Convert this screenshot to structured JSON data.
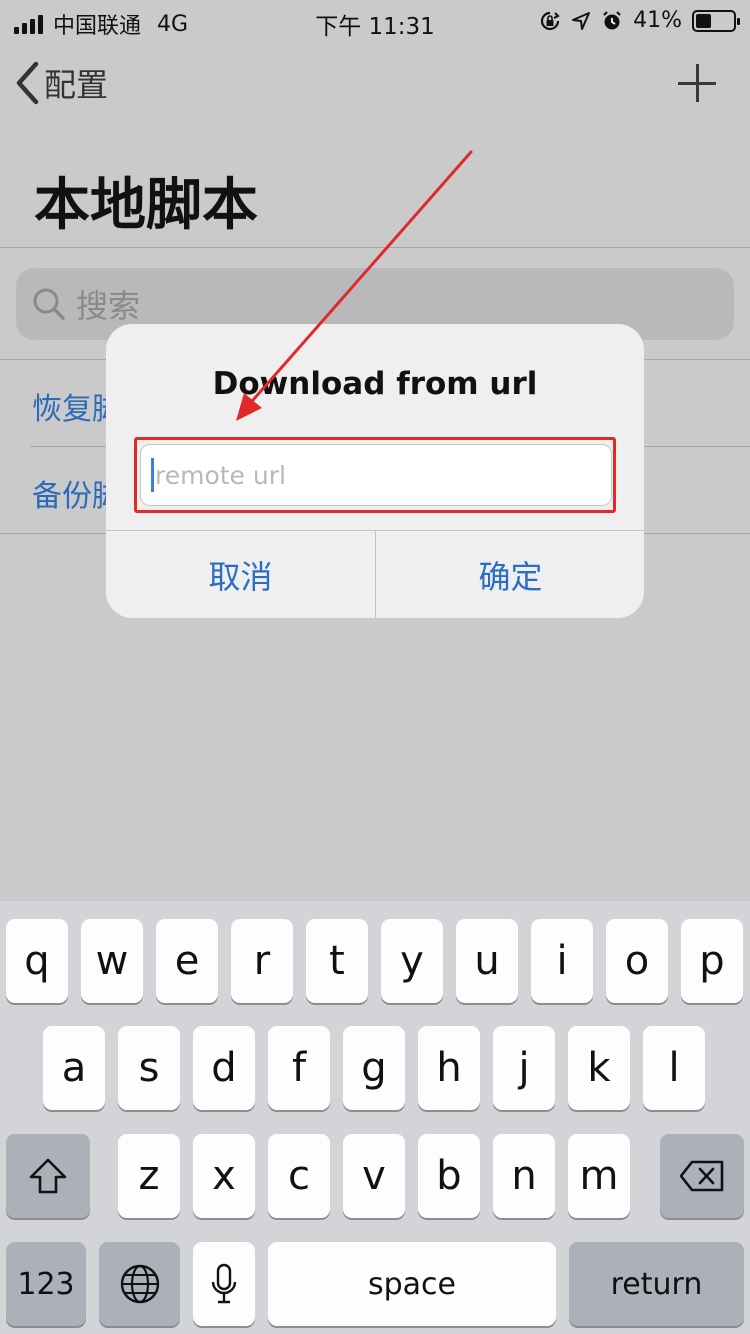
{
  "status_bar": {
    "carrier": "中国联通",
    "network": "4G",
    "time": "下午 11:31",
    "battery": "41%",
    "battery_level": 0.41
  },
  "nav": {
    "back_label": "配置",
    "add_icon": "plus-icon"
  },
  "page": {
    "title": "本地脚本",
    "search_placeholder": "搜索",
    "list_items": [
      "恢复脚",
      "备份脚"
    ]
  },
  "dialog": {
    "title": "Download from url",
    "input_placeholder": "remote url",
    "cancel_label": "取消",
    "confirm_label": "确定"
  },
  "annotation": {
    "arrow_color": "#e02a2a",
    "highlight_color": "#e02a2a"
  },
  "keyboard": {
    "row1": [
      "q",
      "w",
      "e",
      "r",
      "t",
      "y",
      "u",
      "i",
      "o",
      "p"
    ],
    "row2": [
      "a",
      "s",
      "d",
      "f",
      "g",
      "h",
      "j",
      "k",
      "l"
    ],
    "row3": [
      "z",
      "x",
      "c",
      "v",
      "b",
      "n",
      "m"
    ],
    "numbers_label": "123",
    "space_label": "space",
    "return_label": "return",
    "shift_icon": "shift-icon",
    "delete_icon": "backspace-icon",
    "globe_icon": "globe-icon",
    "mic_icon": "microphone-icon"
  }
}
